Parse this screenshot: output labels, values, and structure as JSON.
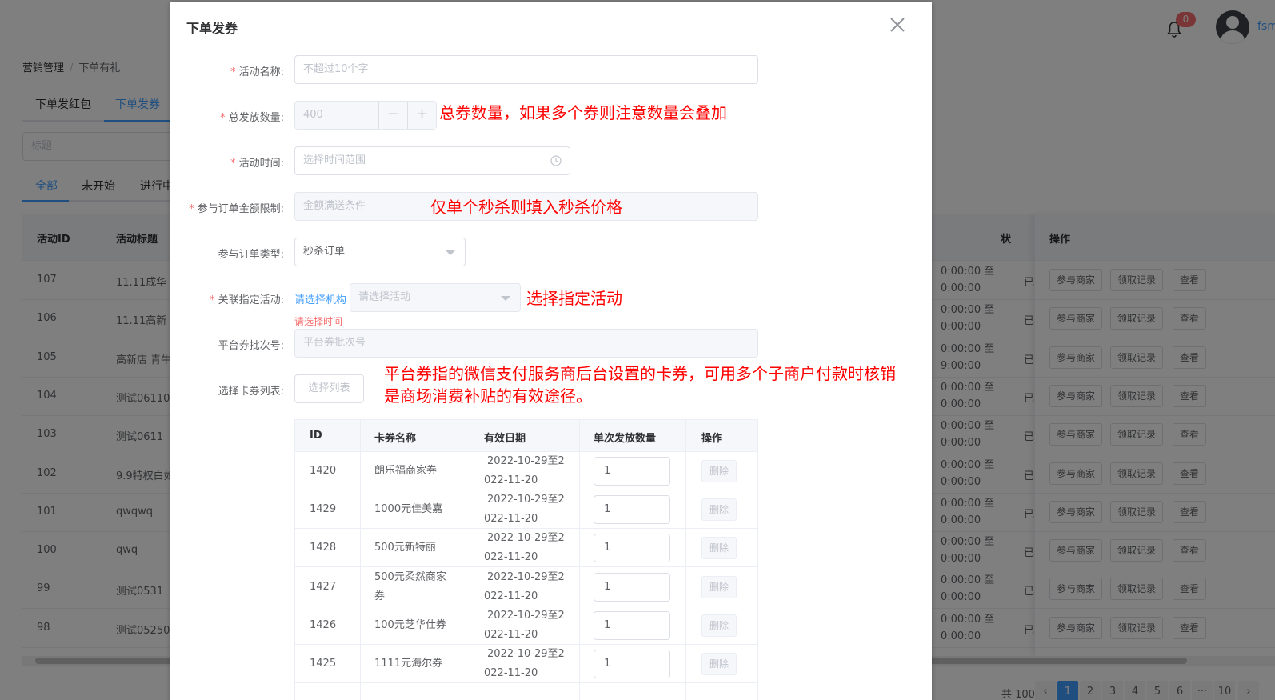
{
  "header": {
    "badge_count": "0",
    "user_name": "fsm"
  },
  "breadcrumb": {
    "items": [
      "营销管理",
      "下单有礼"
    ],
    "separator": "/"
  },
  "page_tabs": [
    "下单发红包",
    "下单发券"
  ],
  "search": {
    "placeholder": "标题"
  },
  "status_tabs": [
    "全部",
    "未开始",
    "进行中"
  ],
  "table": {
    "headers": {
      "id": "活动ID",
      "title": "活动标题",
      "status": "状",
      "ops": "操作"
    },
    "rows": [
      {
        "id": "107",
        "title": "11.11成华",
        "dt1": "0:00:00 至",
        "dt2": "0:00:00",
        "status": "已"
      },
      {
        "id": "106",
        "title": "11.11高新",
        "dt1": "0:00:00 至",
        "dt2": "0:00:00",
        "status": "已"
      },
      {
        "id": "105",
        "title": "高新店 青牛",
        "dt1": "0:00:00 至",
        "dt2": "9:00:00",
        "status": "已"
      },
      {
        "id": "104",
        "title": "测试06110",
        "dt1": "0:00:00 至",
        "dt2": "0:00:00",
        "status": "已"
      },
      {
        "id": "103",
        "title": "测试0611",
        "dt1": "0:00:00 至",
        "dt2": "0:00:00",
        "status": "已"
      },
      {
        "id": "102",
        "title": "9.9特权白如",
        "dt1": "0:00:00 至",
        "dt2": "0:00:00",
        "status": "已"
      },
      {
        "id": "101",
        "title": "qwqwq",
        "dt1": "0:00:00 至",
        "dt2": "0:00:00",
        "status": "已"
      },
      {
        "id": "100",
        "title": "qwq",
        "dt1": "0:00:00 至",
        "dt2": "0:00:00",
        "status": "已"
      },
      {
        "id": "99",
        "title": "测试0531",
        "dt1": "0:00:00 至",
        "dt2": "0:00:00",
        "status": "已"
      },
      {
        "id": "98",
        "title": "测试05250",
        "dt1": "0:00:00 至",
        "dt2": "0:00:00",
        "status": "已"
      }
    ],
    "op_labels": {
      "merchants": "参与商家",
      "records": "领取记录",
      "view": "查看"
    }
  },
  "pagination": {
    "total": "共 100 条",
    "pages": [
      "1",
      "2",
      "3",
      "4",
      "5",
      "6",
      "···",
      "10"
    ],
    "current": "1"
  },
  "dialog": {
    "title": "下单发券",
    "fields": {
      "name": {
        "label": "活动名称:",
        "placeholder": "不超过10个字"
      },
      "total": {
        "label": "总发放数量:",
        "value": "400",
        "minus": "−",
        "plus": "+"
      },
      "time": {
        "label": "活动时间:",
        "placeholder": "选择时间范围"
      },
      "amount": {
        "label": "参与订单金额限制:",
        "placeholder": "金额满送条件"
      },
      "order_type": {
        "label": "参与订单类型:",
        "value": "秒杀订单"
      },
      "linked": {
        "label": "关联指定活动:",
        "link": "请选择机构",
        "placeholder": "请选择活动",
        "error": "请选择时间"
      },
      "batch": {
        "label": "平台券批次号:",
        "placeholder": "平台券批次号"
      },
      "cards": {
        "label": "选择卡券列表:",
        "button": "选择列表"
      }
    },
    "required_mark": "*",
    "annotations": {
      "total": "总券数量，如果多个券则注意数量会叠加",
      "amount": "仅单个秒杀则填入秒杀价格",
      "linked": "选择指定活动",
      "platform_line1": "平台券指的微信支付服务商后台设置的卡券，可用多个子商户付款时核销",
      "platform_line2": "是商场消费补贴的有效途径。"
    },
    "card_table": {
      "headers": {
        "id": "ID",
        "name": "卡券名称",
        "date": "有效日期",
        "qty": "单次发放数量",
        "op": "操作"
      },
      "delete_label": "删除",
      "rows": [
        {
          "id": "1420",
          "name1": "朗乐福商家券",
          "name2": "",
          "d1": "2022-10-29至2",
          "d2": "022-11-20",
          "qty": "1"
        },
        {
          "id": "1429",
          "name1": "1000元佳美嘉",
          "name2": "",
          "d1": "2022-10-29至2",
          "d2": "022-11-20",
          "qty": "1"
        },
        {
          "id": "1428",
          "name1": "500元新特丽",
          "name2": "",
          "d1": "2022-10-29至2",
          "d2": "022-11-20",
          "qty": "1"
        },
        {
          "id": "1427",
          "name1": "500元柔然商家",
          "name2": "券",
          "d1": "2022-10-29至2",
          "d2": "022-11-20",
          "qty": "1"
        },
        {
          "id": "1426",
          "name1": "100元芝华仕券",
          "name2": "",
          "d1": "2022-10-29至2",
          "d2": "022-11-20",
          "qty": "1"
        },
        {
          "id": "1425",
          "name1": "1111元海尔券",
          "name2": "",
          "d1": "2022-10-29至2",
          "d2": "022-11-20",
          "qty": "1"
        }
      ]
    }
  }
}
